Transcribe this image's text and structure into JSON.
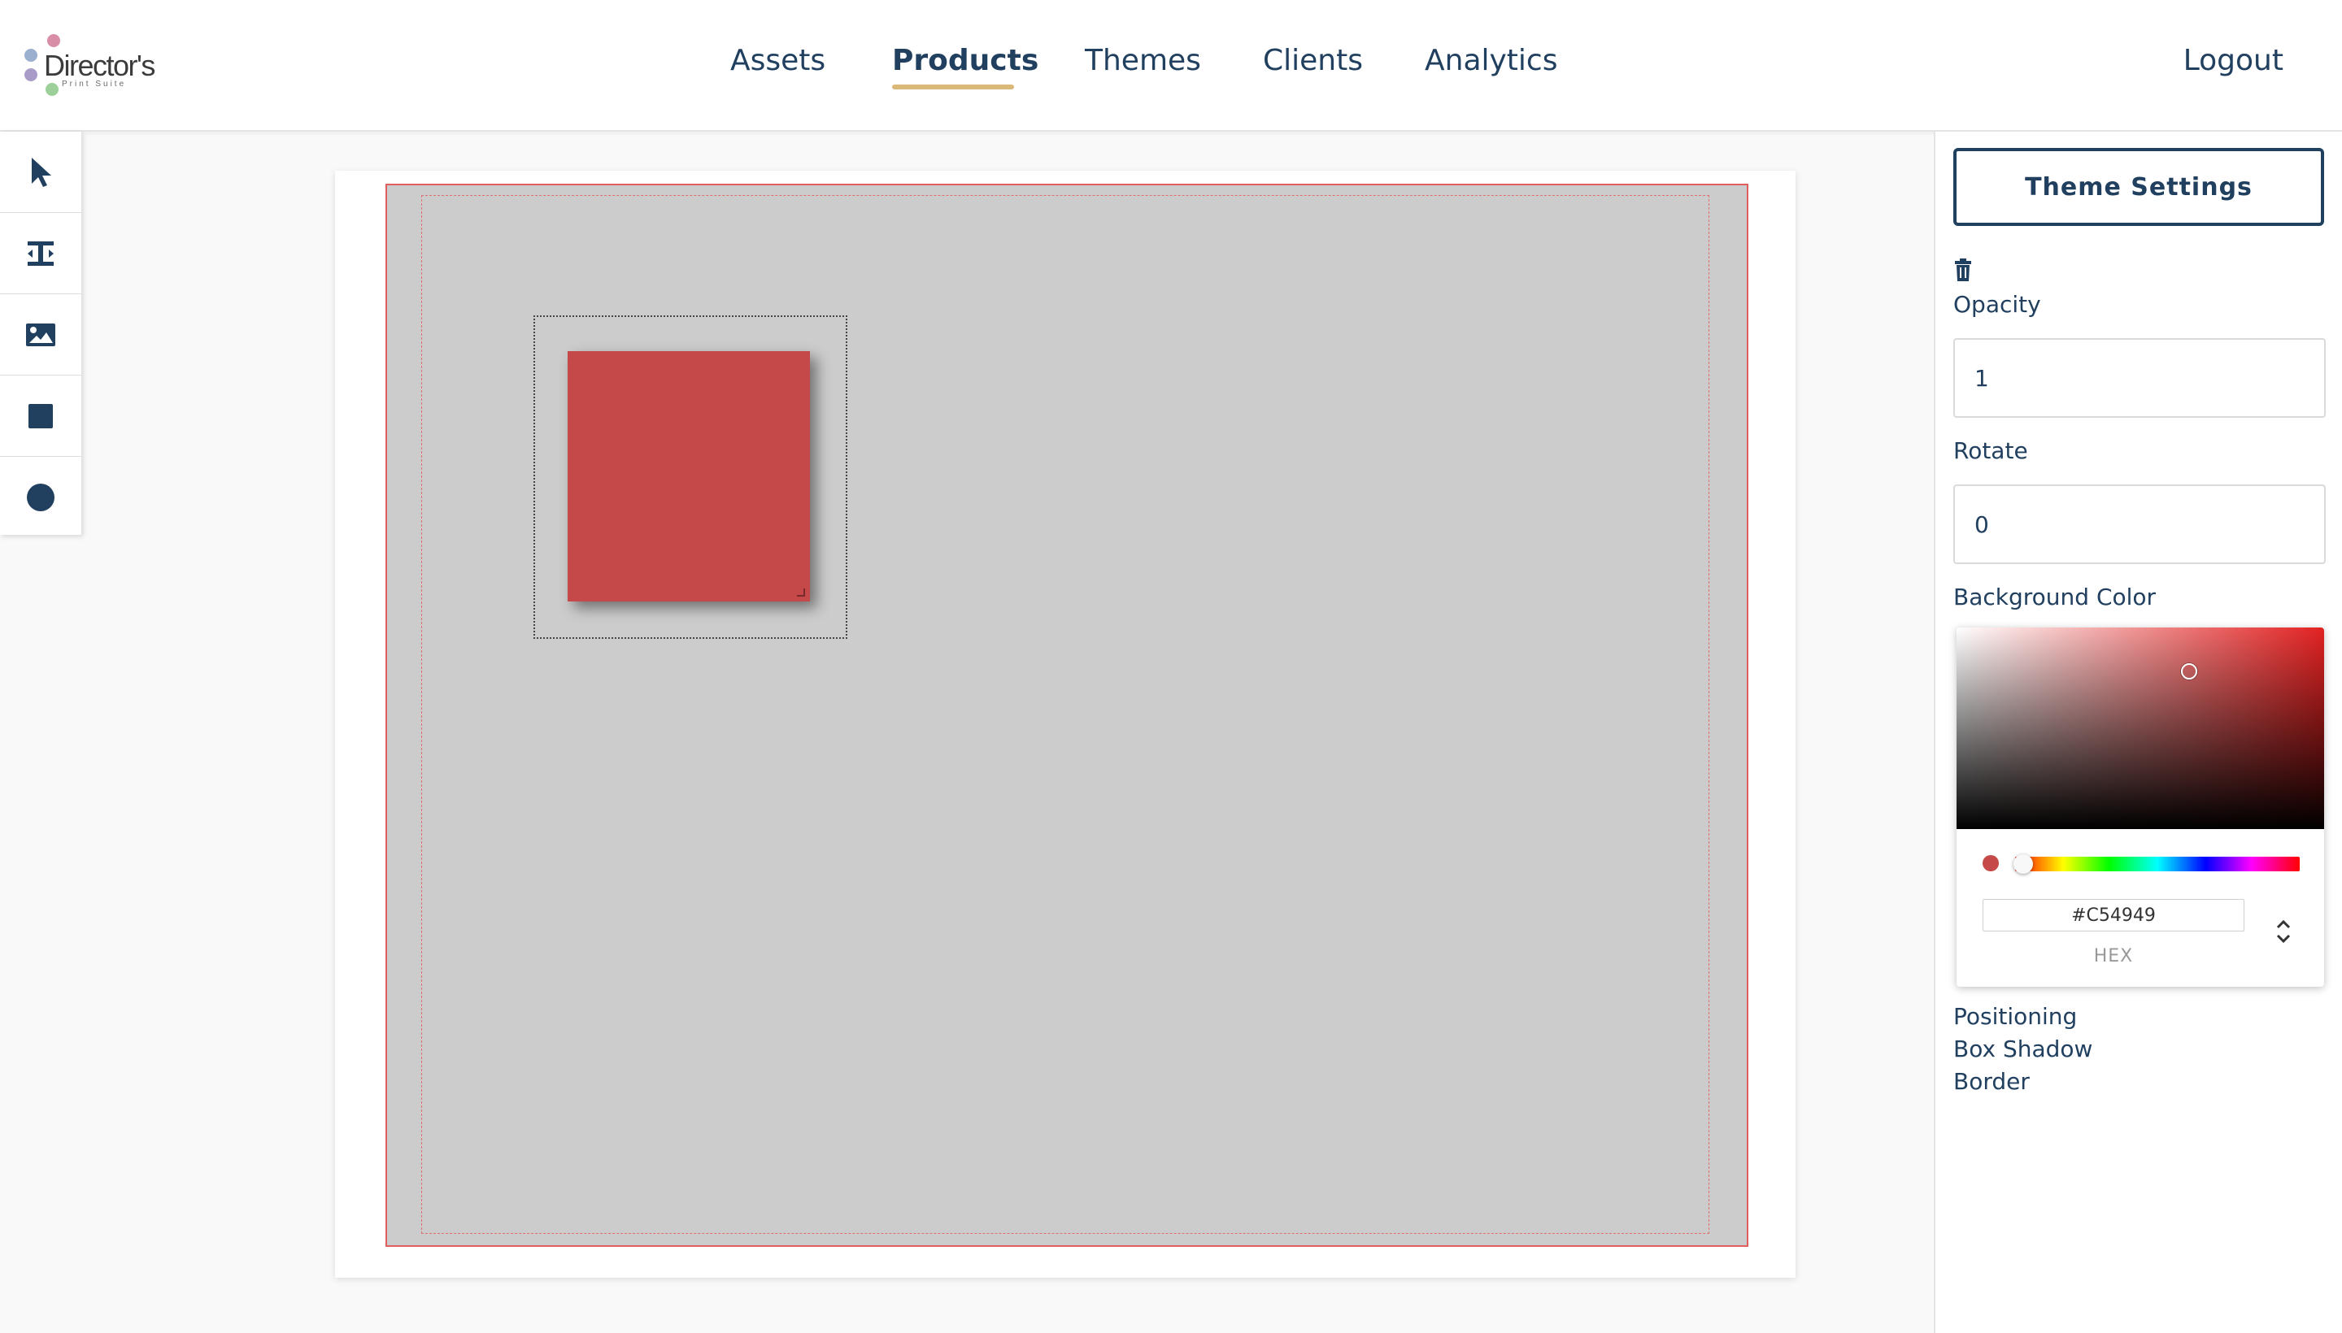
{
  "app": {
    "logo_text": "Director's",
    "logo_subtext": "Print Suite"
  },
  "nav": {
    "items": [
      {
        "label": "Assets"
      },
      {
        "label": "Products"
      },
      {
        "label": "Themes"
      },
      {
        "label": "Clients"
      },
      {
        "label": "Analytics"
      }
    ],
    "active": "Products",
    "logout_label": "Logout"
  },
  "toolbar": {
    "tools": [
      {
        "icon": "pointer-icon"
      },
      {
        "icon": "text-icon"
      },
      {
        "icon": "image-icon"
      },
      {
        "icon": "square-icon"
      },
      {
        "icon": "circle-icon"
      }
    ]
  },
  "canvas": {
    "selected_shape": {
      "type": "rectangle",
      "fill_color": "#C54949"
    }
  },
  "panel": {
    "theme_settings_label": "Theme Settings",
    "delete_icon": "trash-icon",
    "opacity_label": "Opacity",
    "opacity_value": "1",
    "rotate_label": "Rotate",
    "rotate_value": "0",
    "background_color_label": "Background Color",
    "color_picker": {
      "hex_value": "#C54949",
      "mode_label": "HEX",
      "swatch_color": "#C54949"
    },
    "sections": {
      "positioning": "Positioning",
      "box_shadow": "Box Shadow",
      "border": "Border"
    }
  },
  "colors": {
    "nav_text": "#21405F",
    "accent_underline": "#D9B878",
    "artboard_bg": "#CCCCCC",
    "bleed_line": "#E06060"
  }
}
